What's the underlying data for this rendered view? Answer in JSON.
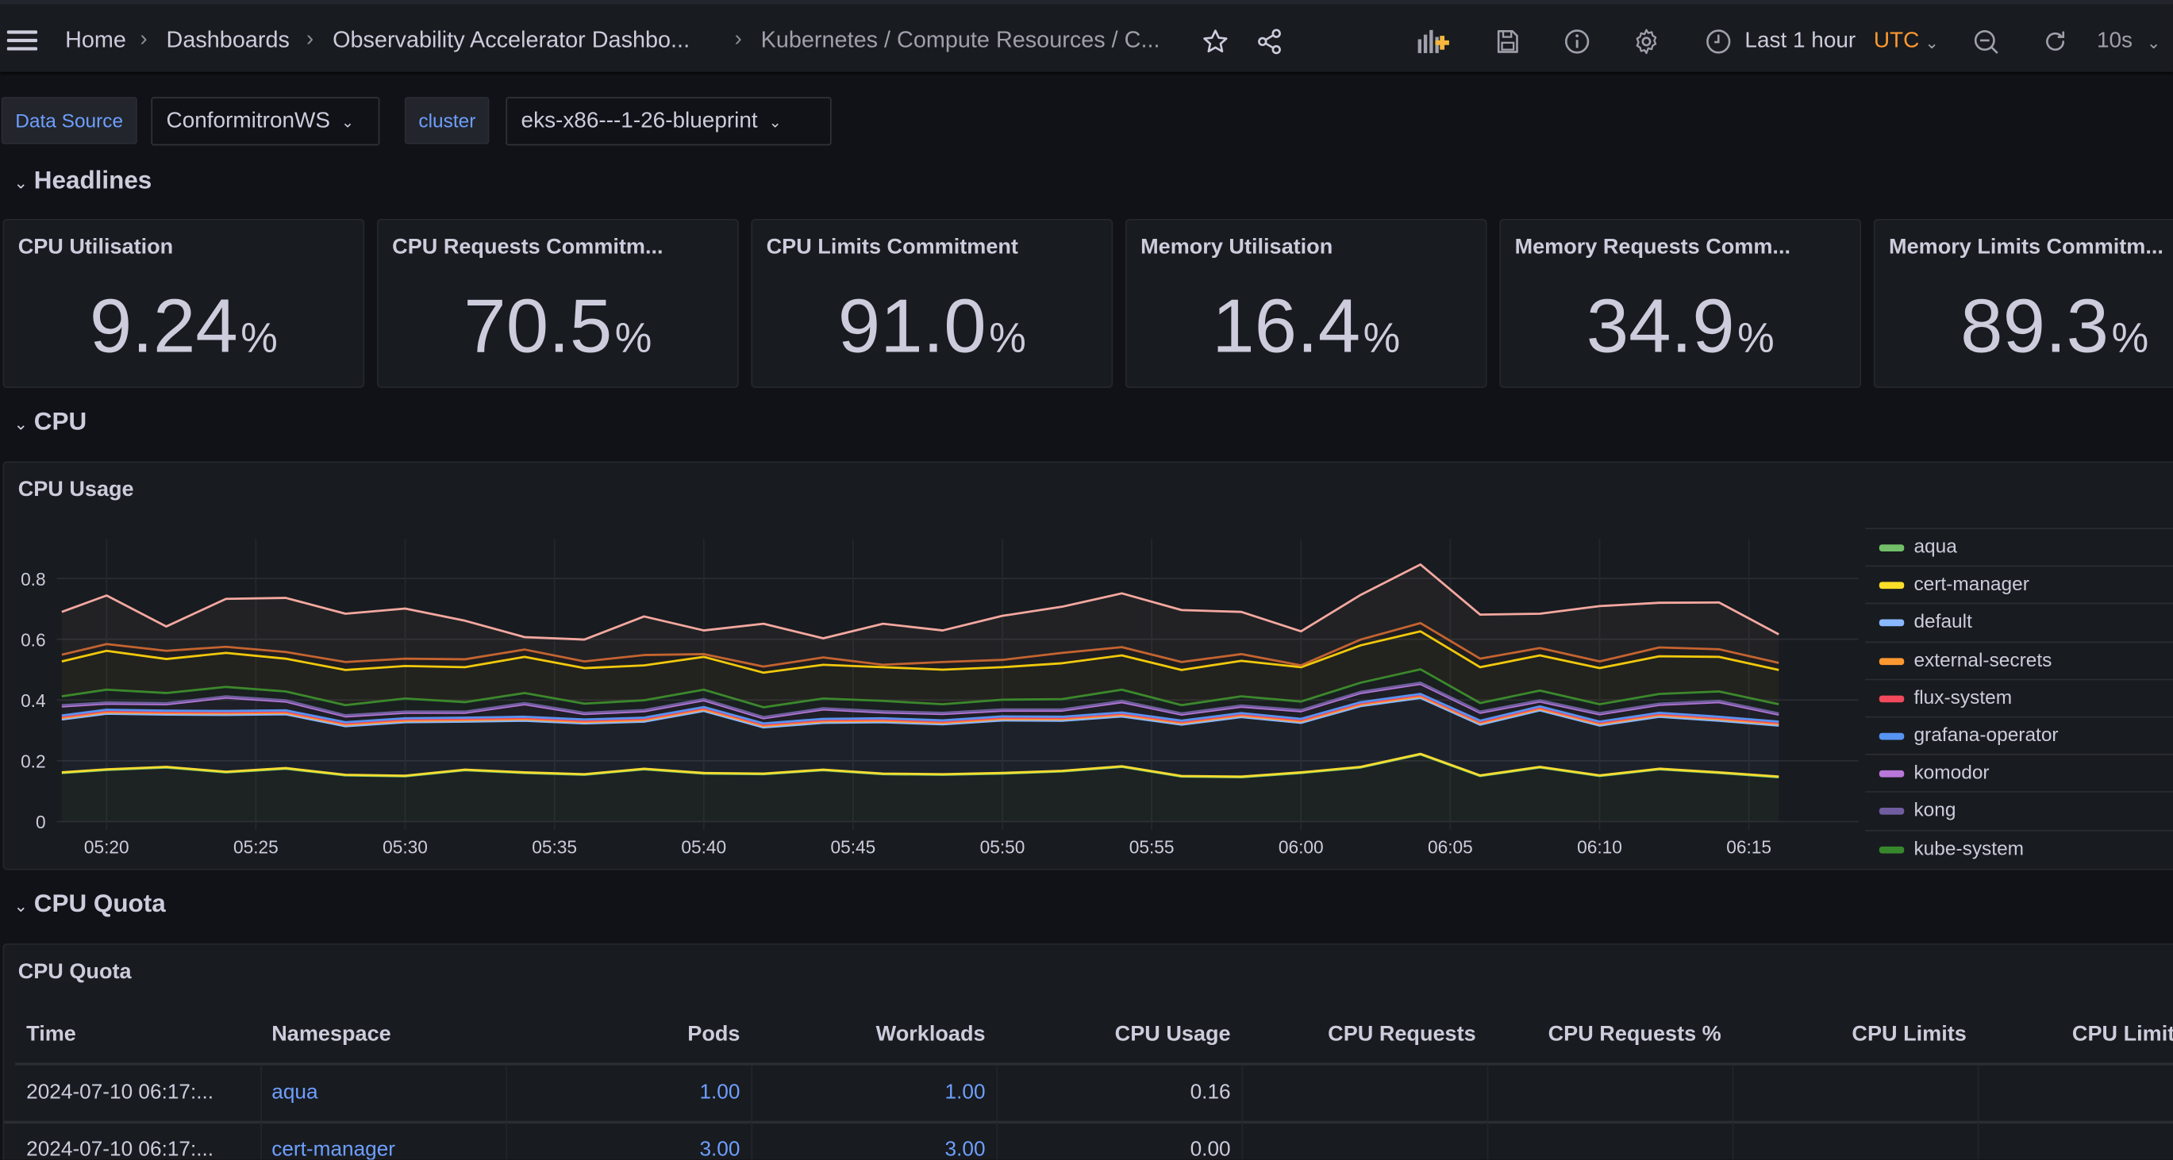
{
  "topbar": {
    "breadcrumbs": [
      "Home",
      "Dashboards",
      "Observability Accelerator Dashbo...",
      "Kubernetes / Compute Resources / C..."
    ],
    "time_range": "Last 1 hour",
    "timezone": "UTC",
    "refresh_interval": "10s",
    "icons": [
      "menu-icon",
      "star-icon",
      "share-icon",
      "add-panel-icon",
      "save-icon",
      "info-icon",
      "gear-icon",
      "clock-icon",
      "zoom-out-icon",
      "refresh-icon"
    ]
  },
  "variables": [
    {
      "label": "Data Source",
      "value": "ConformitronWS"
    },
    {
      "label": "cluster",
      "value": "eks-x86---1-26-blueprint"
    }
  ],
  "rows": {
    "headlines": "Headlines",
    "cpu": "CPU",
    "cpu_quota": "CPU Quota"
  },
  "stats": [
    {
      "title": "CPU Utilisation",
      "value": "9.24",
      "unit": "%"
    },
    {
      "title": "CPU Requests Commitm...",
      "value": "70.5",
      "unit": "%"
    },
    {
      "title": "CPU Limits Commitment",
      "value": "91.0",
      "unit": "%"
    },
    {
      "title": "Memory Utilisation",
      "value": "16.4",
      "unit": "%"
    },
    {
      "title": "Memory Requests Comm...",
      "value": "34.9",
      "unit": "%"
    },
    {
      "title": "Memory Limits Commitm...",
      "value": "89.3",
      "unit": "%"
    }
  ],
  "cpu_usage_panel": {
    "title": "CPU Usage"
  },
  "chart_data": {
    "type": "line",
    "stacked": true,
    "fill": true,
    "title": "CPU Usage",
    "xlim": [
      "05:18:20",
      "06:18:40"
    ],
    "ylim": [
      0,
      0.93
    ],
    "yticks": [
      "0",
      "0.2",
      "0.4",
      "0.6",
      "0.8"
    ],
    "xticks": [
      "05:20",
      "05:25",
      "05:30",
      "05:35",
      "05:40",
      "05:45",
      "05:50",
      "05:55",
      "06:00",
      "06:05",
      "06:10",
      "06:15"
    ],
    "grid": true,
    "legend_placement": "right",
    "x": [
      "05:18:30",
      "05:20",
      "05:22",
      "05:24",
      "05:26",
      "05:28",
      "05:30",
      "05:32",
      "05:34",
      "05:36",
      "05:38",
      "05:40",
      "05:42",
      "05:44",
      "05:46",
      "05:48",
      "05:50",
      "05:52",
      "05:54",
      "05:56",
      "05:58",
      "06:00",
      "06:02",
      "06:04",
      "06:06",
      "06:08",
      "06:10",
      "06:12",
      "06:14",
      "06:16"
    ],
    "series": [
      {
        "name": "aqua",
        "color": "#73bf69",
        "values": [
          0.16,
          0.17,
          0.178,
          0.162,
          0.174,
          0.152,
          0.149,
          0.169,
          0.16,
          0.154,
          0.172,
          0.158,
          0.156,
          0.169,
          0.156,
          0.154,
          0.158,
          0.165,
          0.18,
          0.148,
          0.146,
          0.16,
          0.178,
          0.221,
          0.15,
          0.178,
          0.15,
          0.172,
          0.16,
          0.146
        ]
      },
      {
        "name": "cert-manager",
        "color": "#fade2a",
        "values": [
          0.002,
          0.002,
          0.002,
          0.002,
          0.002,
          0.002,
          0.002,
          0.002,
          0.002,
          0.002,
          0.002,
          0.002,
          0.002,
          0.002,
          0.002,
          0.002,
          0.002,
          0.002,
          0.002,
          0.002,
          0.002,
          0.002,
          0.002,
          0.002,
          0.002,
          0.002,
          0.002,
          0.002,
          0.002,
          0.002
        ]
      },
      {
        "name": "default",
        "color": "#8ab8ff",
        "values": [
          0.174,
          0.183,
          0.172,
          0.187,
          0.177,
          0.16,
          0.176,
          0.158,
          0.17,
          0.167,
          0.155,
          0.204,
          0.152,
          0.154,
          0.169,
          0.164,
          0.173,
          0.165,
          0.164,
          0.169,
          0.196,
          0.163,
          0.2,
          0.184,
          0.167,
          0.186,
          0.164,
          0.171,
          0.17,
          0.168
        ]
      },
      {
        "name": "external-secrets",
        "color": "#ff9830",
        "values": [
          0.005,
          0.005,
          0.005,
          0.005,
          0.005,
          0.005,
          0.005,
          0.005,
          0.005,
          0.005,
          0.005,
          0.005,
          0.005,
          0.005,
          0.005,
          0.005,
          0.005,
          0.005,
          0.005,
          0.005,
          0.005,
          0.005,
          0.005,
          0.005,
          0.005,
          0.005,
          0.005,
          0.005,
          0.005,
          0.005
        ]
      },
      {
        "name": "flux-system",
        "color": "#f2495c",
        "values": [
          0.004,
          0.004,
          0.004,
          0.004,
          0.004,
          0.004,
          0.004,
          0.004,
          0.004,
          0.004,
          0.004,
          0.004,
          0.004,
          0.004,
          0.004,
          0.004,
          0.004,
          0.004,
          0.004,
          0.004,
          0.004,
          0.004,
          0.004,
          0.004,
          0.004,
          0.004,
          0.004,
          0.004,
          0.004,
          0.004
        ]
      },
      {
        "name": "grafana-operator",
        "color": "#5794f2",
        "values": [
          0.004,
          0.004,
          0.004,
          0.004,
          0.004,
          0.004,
          0.004,
          0.004,
          0.004,
          0.004,
          0.004,
          0.004,
          0.004,
          0.004,
          0.004,
          0.004,
          0.004,
          0.004,
          0.004,
          0.004,
          0.004,
          0.004,
          0.004,
          0.004,
          0.004,
          0.004,
          0.004,
          0.004,
          0.004,
          0.004
        ]
      },
      {
        "name": "komodor",
        "color": "#b877d9",
        "values": [
          0.03,
          0.02,
          0.021,
          0.044,
          0.029,
          0.019,
          0.018,
          0.016,
          0.041,
          0.018,
          0.021,
          0.022,
          0.017,
          0.031,
          0.019,
          0.021,
          0.019,
          0.02,
          0.034,
          0.02,
          0.021,
          0.025,
          0.03,
          0.033,
          0.026,
          0.016,
          0.024,
          0.026,
          0.048,
          0.023
        ]
      },
      {
        "name": "kong",
        "color": "#705da0",
        "values": [
          0.004,
          0.004,
          0.004,
          0.004,
          0.004,
          0.004,
          0.004,
          0.004,
          0.004,
          0.004,
          0.004,
          0.004,
          0.004,
          0.004,
          0.004,
          0.004,
          0.004,
          0.004,
          0.004,
          0.004,
          0.004,
          0.004,
          0.004,
          0.004,
          0.004,
          0.004,
          0.004,
          0.004,
          0.004,
          0.004
        ]
      },
      {
        "name": "kube-system",
        "color": "#37872d",
        "values": [
          0.029,
          0.042,
          0.033,
          0.031,
          0.029,
          0.033,
          0.043,
          0.031,
          0.033,
          0.03,
          0.032,
          0.031,
          0.032,
          0.032,
          0.034,
          0.028,
          0.032,
          0.034,
          0.037,
          0.027,
          0.03,
          0.028,
          0.03,
          0.044,
          0.028,
          0.032,
          0.029,
          0.032,
          0.031,
          0.03
        ]
      },
      {
        "color": "#f2cc0c",
        "values": [
          0.115,
          0.128,
          0.112,
          0.112,
          0.108,
          0.116,
          0.107,
          0.115,
          0.119,
          0.117,
          0.115,
          0.108,
          0.114,
          0.111,
          0.111,
          0.114,
          0.107,
          0.118,
          0.113,
          0.116,
          0.117,
          0.113,
          0.123,
          0.125,
          0.118,
          0.116,
          0.119,
          0.124,
          0.114,
          0.113
        ]
      },
      {
        "color": "#c4622d",
        "values": [
          0.022,
          0.022,
          0.027,
          0.02,
          0.022,
          0.026,
          0.024,
          0.026,
          0.024,
          0.022,
          0.034,
          0.009,
          0.02,
          0.024,
          0.008,
          0.025,
          0.024,
          0.034,
          0.027,
          0.026,
          0.022,
          0.006,
          0.019,
          0.027,
          0.028,
          0.024,
          0.022,
          0.029,
          0.025,
          0.023
        ]
      },
      {
        "color": "#f4a8a0",
        "values": [
          0.141,
          0.16,
          0.08,
          0.158,
          0.178,
          0.159,
          0.165,
          0.127,
          0.041,
          0.072,
          0.127,
          0.078,
          0.141,
          0.063,
          0.135,
          0.104,
          0.145,
          0.152,
          0.177,
          0.171,
          0.139,
          0.112,
          0.147,
          0.193,
          0.145,
          0.113,
          0.182,
          0.147,
          0.154,
          0.094
        ]
      }
    ]
  },
  "cpu_quota_panel": {
    "title": "CPU Quota",
    "columns": [
      "Time",
      "Namespace",
      "Pods",
      "Workloads",
      "CPU Usage",
      "CPU Requests",
      "CPU Requests %",
      "CPU Limits",
      "CPU Limits %"
    ],
    "rows": [
      {
        "time": "2024-07-10 06:17:...",
        "namespace": "aqua",
        "pods": "1.00",
        "workloads": "1.00",
        "cpu_usage": "0.16"
      },
      {
        "time": "2024-07-10 06:17:...",
        "namespace": "cert-manager",
        "pods": "3.00",
        "workloads": "3.00",
        "cpu_usage": "0.00"
      }
    ]
  },
  "colors": {
    "background": "#111217",
    "panel": "#181b1f",
    "text": "#ccccdc",
    "link": "#6e9fff",
    "utc": "#ff9830"
  }
}
